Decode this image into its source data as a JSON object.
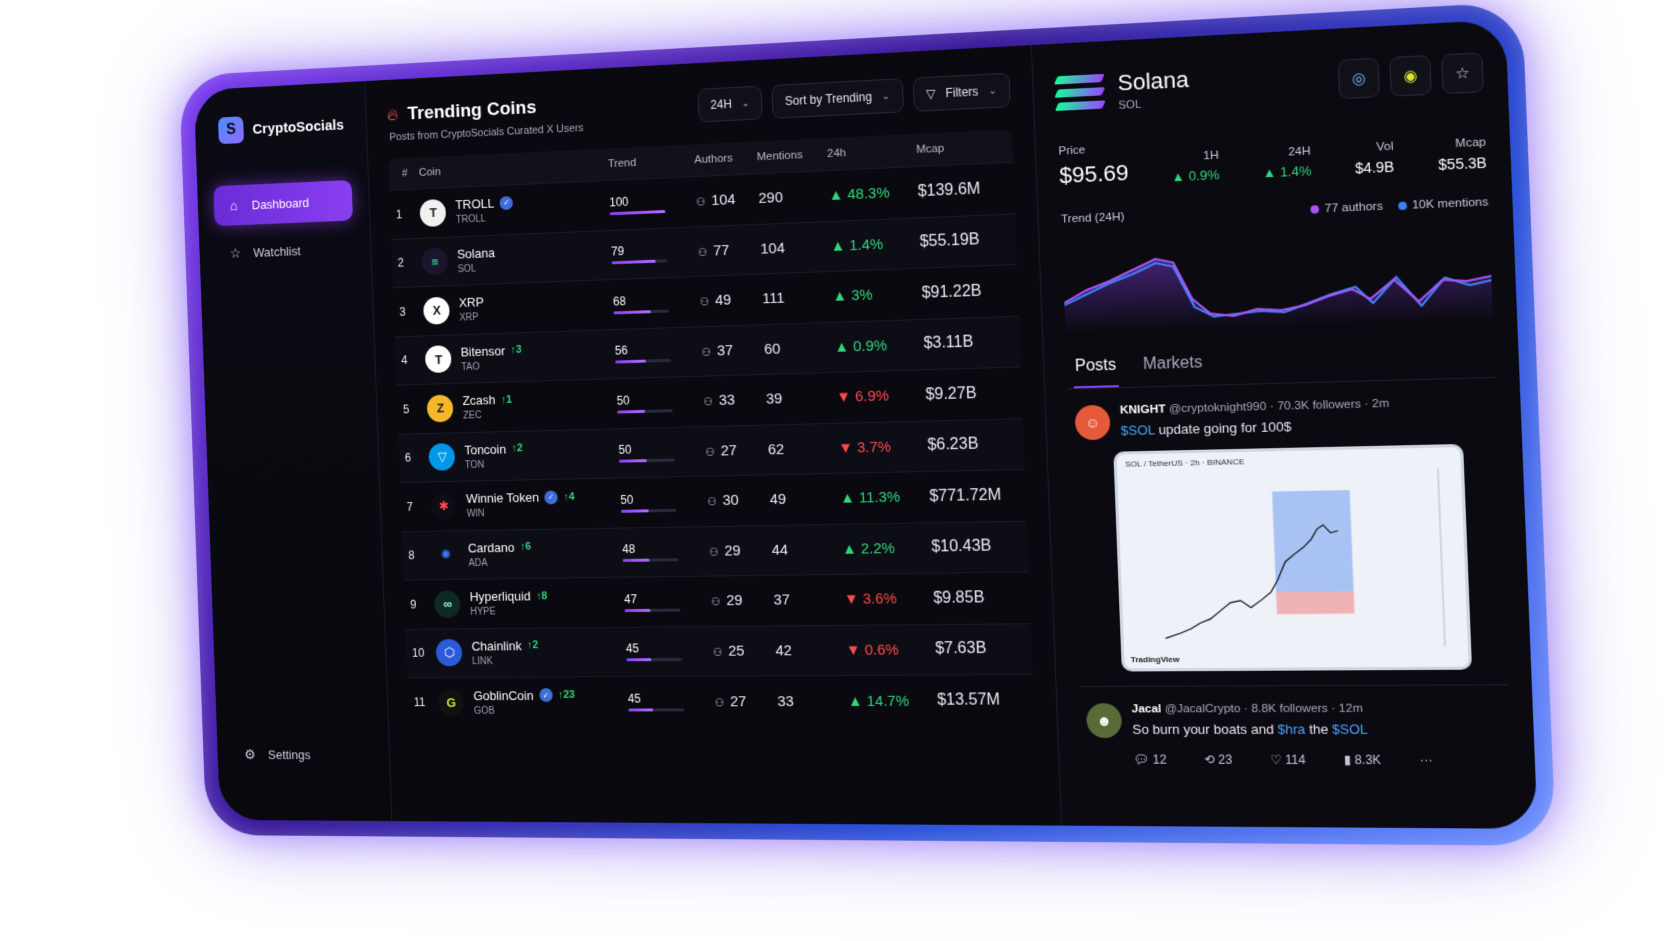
{
  "app": {
    "brand": "CryptoSocials"
  },
  "sidebar": {
    "items": [
      {
        "label": "Dashboard",
        "icon": "home-icon"
      },
      {
        "label": "Watchlist",
        "icon": "star-icon"
      }
    ],
    "settings_label": "Settings"
  },
  "main": {
    "title": "Trending Coins",
    "subtitle": "Posts from CryptoSocials Curated X Users",
    "timeframe": "24H",
    "sort": "Sort by Trending",
    "filters": "Filters",
    "columns": [
      "#",
      "Coin",
      "Trend",
      "Authors",
      "Mentions",
      "24h",
      "Mcap"
    ],
    "rows": [
      {
        "rank": "1",
        "name": "TROLL",
        "symbol": "TROLL",
        "verified": true,
        "rise": "",
        "trend": 100,
        "authors": "104",
        "mentions": "290",
        "change": "48.3%",
        "dir": "up",
        "mcap": "$139.6M",
        "logo": "T",
        "logo_bg": "#f1f1f1",
        "logo_fg": "#222"
      },
      {
        "rank": "2",
        "name": "Solana",
        "symbol": "SOL",
        "verified": false,
        "rise": "",
        "trend": 79,
        "authors": "77",
        "mentions": "104",
        "change": "1.4%",
        "dir": "up",
        "mcap": "$55.19B",
        "logo": "≡",
        "logo_bg": "#1b1530",
        "logo_fg": "#19fb9b"
      },
      {
        "rank": "3",
        "name": "XRP",
        "symbol": "XRP",
        "verified": false,
        "rise": "",
        "trend": 68,
        "authors": "49",
        "mentions": "111",
        "change": "3%",
        "dir": "up",
        "mcap": "$91.22B",
        "logo": "X",
        "logo_bg": "#ffffff",
        "logo_fg": "#111"
      },
      {
        "rank": "4",
        "name": "Bitensor",
        "symbol": "TAO",
        "verified": false,
        "rise": "↑3",
        "trend": 56,
        "authors": "37",
        "mentions": "60",
        "change": "0.9%",
        "dir": "up",
        "mcap": "$3.11B",
        "logo": "T",
        "logo_bg": "#ffffff",
        "logo_fg": "#111"
      },
      {
        "rank": "5",
        "name": "Zcash",
        "symbol": "ZEC",
        "verified": false,
        "rise": "↑1",
        "trend": 50,
        "authors": "33",
        "mentions": "39",
        "change": "6.9%",
        "dir": "down",
        "mcap": "$9.27B",
        "logo": "Z",
        "logo_bg": "#f4b728",
        "logo_fg": "#1a1a1a"
      },
      {
        "rank": "6",
        "name": "Toncoin",
        "symbol": "TON",
        "verified": false,
        "rise": "↑2",
        "trend": 50,
        "authors": "27",
        "mentions": "62",
        "change": "3.7%",
        "dir": "down",
        "mcap": "$6.23B",
        "logo": "▽",
        "logo_bg": "#0098ea",
        "logo_fg": "#ffffff"
      },
      {
        "rank": "7",
        "name": "Winnie Token",
        "symbol": "WIN",
        "verified": true,
        "rise": "↑4",
        "trend": 50,
        "authors": "30",
        "mentions": "49",
        "change": "11.3%",
        "dir": "up",
        "mcap": "$771.72M",
        "logo": "✱",
        "logo_bg": "#0d0d15",
        "logo_fg": "#ff4a4a"
      },
      {
        "rank": "8",
        "name": "Cardano",
        "symbol": "ADA",
        "verified": false,
        "rise": "↑6",
        "trend": 48,
        "authors": "29",
        "mentions": "44",
        "change": "2.2%",
        "dir": "up",
        "mcap": "$10.43B",
        "logo": "✺",
        "logo_bg": "#0d0d15",
        "logo_fg": "#3a7cff"
      },
      {
        "rank": "9",
        "name": "Hyperliquid",
        "symbol": "HYPE",
        "verified": false,
        "rise": "↑8",
        "trend": 47,
        "authors": "29",
        "mentions": "37",
        "change": "3.6%",
        "dir": "down",
        "mcap": "$9.85B",
        "logo": "∞",
        "logo_bg": "#0f2a24",
        "logo_fg": "#97fce4"
      },
      {
        "rank": "10",
        "name": "Chainlink",
        "symbol": "LINK",
        "verified": false,
        "rise": "↑2",
        "trend": 45,
        "authors": "25",
        "mentions": "42",
        "change": "0.6%",
        "dir": "down",
        "mcap": "$7.63B",
        "logo": "⬡",
        "logo_bg": "#2a5ada",
        "logo_fg": "#ffffff"
      },
      {
        "rank": "11",
        "name": "GoblinCoin",
        "symbol": "GOB",
        "verified": true,
        "rise": "↑23",
        "trend": 45,
        "authors": "27",
        "mentions": "33",
        "change": "14.7%",
        "dir": "up",
        "mcap": "$13.57M",
        "logo": "G",
        "logo_bg": "#111",
        "logo_fg": "#d6e32a"
      }
    ]
  },
  "detail": {
    "name": "Solana",
    "symbol": "SOL",
    "price_label": "Price",
    "price": "$95.69",
    "h1_label": "1H",
    "h1": "0.9%",
    "h24_label": "24H",
    "h24": "1.4%",
    "vol_label": "Vol",
    "vol": "$4.9B",
    "mcap_label": "Mcap",
    "mcap": "$55.3B",
    "trend_label": "Trend (24H)",
    "authors_legend": "77 authors",
    "mentions_legend": "10K mentions",
    "authors_color": "#a855f7",
    "mentions_color": "#3b82f6",
    "tabs": [
      "Posts",
      "Markets"
    ]
  },
  "posts": [
    {
      "author": "KNIGHT",
      "handle": "@cryptoknight990",
      "followers": "70.3K followers",
      "time": "2m",
      "cashtag": "$SOL",
      "text": " update going for 100$",
      "image_title": "SOL / TetherUS · 2h · BINANCE",
      "image_footer": "TradingView"
    },
    {
      "author": "Jacal",
      "handle": "@JacalCrypto",
      "followers": "8.8K followers",
      "time": "12m",
      "text_a": "So burn your boats and ",
      "cash1": "$hra",
      "text_b": " the ",
      "cash2": "$SOL",
      "replies": "12",
      "reposts": "23",
      "likes": "114",
      "views": "8.3K",
      "more": "···"
    }
  ]
}
